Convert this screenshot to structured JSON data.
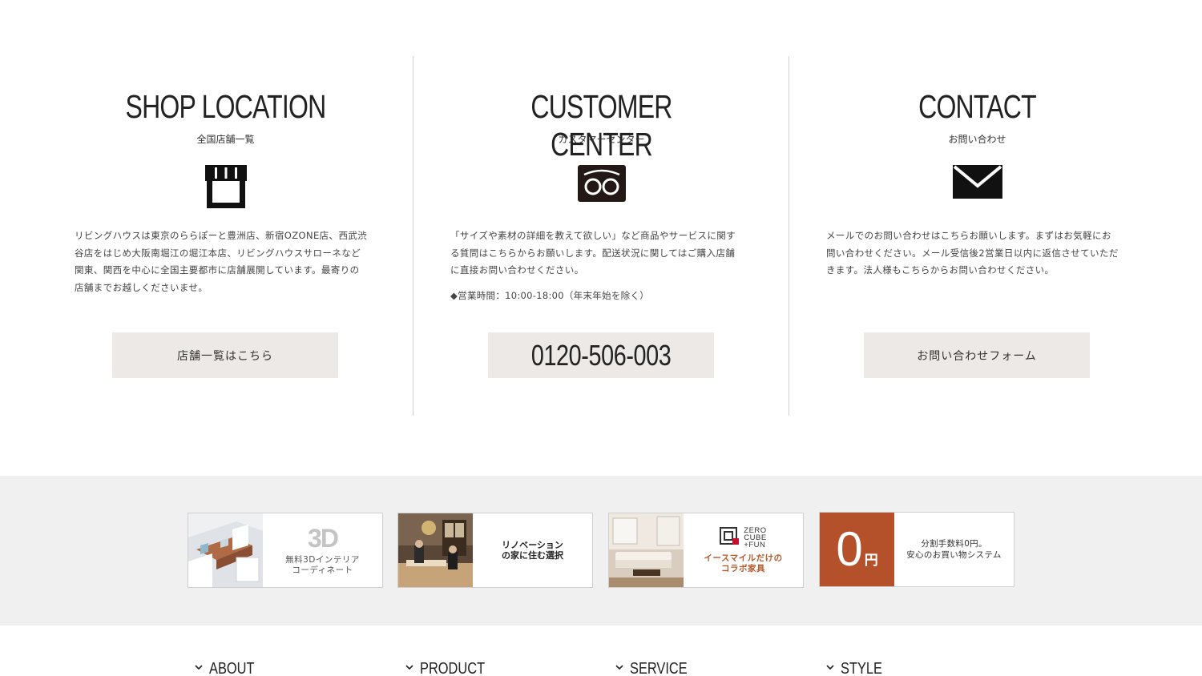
{
  "sections": {
    "shop": {
      "title": "SHOP LOCATION",
      "subtitle": "全国店舗一覧",
      "icon": "storefront-icon",
      "lines": [
        "リビングハウスは東京のららぽーと豊洲店、新宿OZONE店、西武渋",
        "谷店をはじめ大阪南堀江の堀江本店、リビングハウスサローネなど",
        "関東、関西を中心に全国主要都市に店舗展開しています。最寄りの",
        "店舗までお越しくださいませ。"
      ],
      "button": "店舗一覧はこちら"
    },
    "customer": {
      "title": "CUSTOMER CENTER",
      "subtitle": "カスタマーセンター",
      "icon": "freedial-icon",
      "lines": [
        "「サイズや素材の詳細を教えて欲しい」など商品やサービスに関す",
        "る質問はこちらからお願いします。配送状況に関してはご購入店舗",
        "に直接お問い合わせください。"
      ],
      "hours": "◆営業時間：10:00-18:00（年末年始を除く）",
      "phone": "0120-506-003"
    },
    "contact": {
      "title": "CONTACT",
      "subtitle": "お問い合わせ",
      "icon": "envelope-icon",
      "lines": [
        "メールでのお問い合わせはこちらお願いします。まずはお気軽にお",
        "問い合わせください。メール受信後2営業日以内に返信させていただ",
        "きます。法人様もこちらからお問い合わせください。"
      ],
      "button": "お問い合わせフォーム"
    }
  },
  "banners": [
    {
      "badge": "3D",
      "lines": [
        "無料3Dインテリア",
        "コーディネート"
      ]
    },
    {
      "lines": [
        "リノベーション",
        "の家に住む選択"
      ]
    },
    {
      "logo_lines": [
        "ZERO",
        "CUBE",
        "+FUN"
      ],
      "lines": [
        "イースマイルだけの",
        "コラボ家具"
      ]
    },
    {
      "big": "0",
      "unit": "円",
      "lines": [
        "分割手数料0円。",
        "安心のお買い物システム"
      ]
    }
  ],
  "footer_nav": [
    {
      "label": "ABOUT",
      "icon": "chevron-down-icon"
    },
    {
      "label": "PRODUCT",
      "icon": "chevron-down-icon"
    },
    {
      "label": "SERVICE",
      "icon": "chevron-down-icon"
    },
    {
      "label": "STYLE",
      "icon": "chevron-down-icon"
    }
  ],
  "colors": {
    "button_bg": "#ece9e6",
    "banner_strip_bg": "#f0f0f0",
    "accent_orange": "#b4512a",
    "text_dark": "#222222"
  }
}
